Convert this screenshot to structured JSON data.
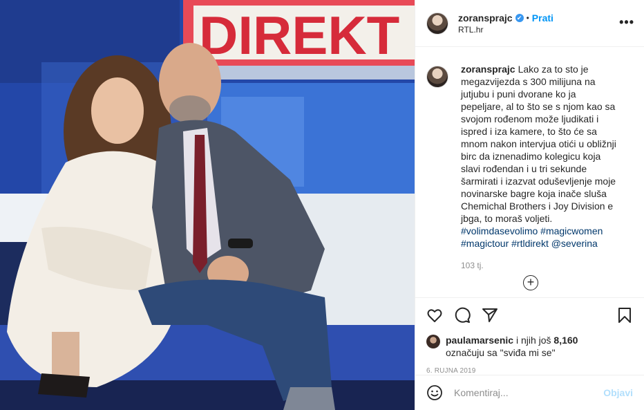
{
  "photo": {
    "sign_text": "DIREKT",
    "colors": {
      "sign_bg": "#d62b3a",
      "studio_blue": "#2347a8",
      "dress": "#f3eee6",
      "jacket": "#4d5566",
      "jeans": "#2e4a78",
      "floor": "#dfe6ec"
    }
  },
  "post": {
    "username": "zoransprajc",
    "verified_mark": "✔",
    "separator": "•",
    "follow_label": "Prati",
    "location": "RTL.hr",
    "more_icon": "•••"
  },
  "caption": {
    "username": "zoransprajc",
    "text": "Lako za to sto je megazvijezda s 300 milijuna na jutjubu i puni dvorane ko ja pepeljare, al to što se s njom kao sa svojom rođenom može ljudikati i ispred i iza kamere, to što će sa mnom nakon intervjua otići u obližnji birc da iznenadimo kolegicu koja slavi rođendan i u tri sekunde šarmirati i izazvat oduševljenje moje novinarske bagre koja inače sluša Chemichal Brothers i Joy Division e jbga, to moraš voljeti.",
    "tags": "#volimdasevolimo #magicwomen #magictour #rtldirekt @severina",
    "time": "103 tj.",
    "add_comment_icon": "+"
  },
  "actions": {
    "icons": [
      "heart-icon",
      "comment-icon",
      "share-icon",
      "bookmark-icon"
    ]
  },
  "likes": {
    "user": "paulamarsenic",
    "middle": " i njih još ",
    "count": "8,160",
    "suffix": "označuju sa \"sviđa mi se\""
  },
  "date": "6. RUJNA 2019",
  "comment_box": {
    "placeholder": "Komentiraj...",
    "post_label": "Objavi"
  }
}
